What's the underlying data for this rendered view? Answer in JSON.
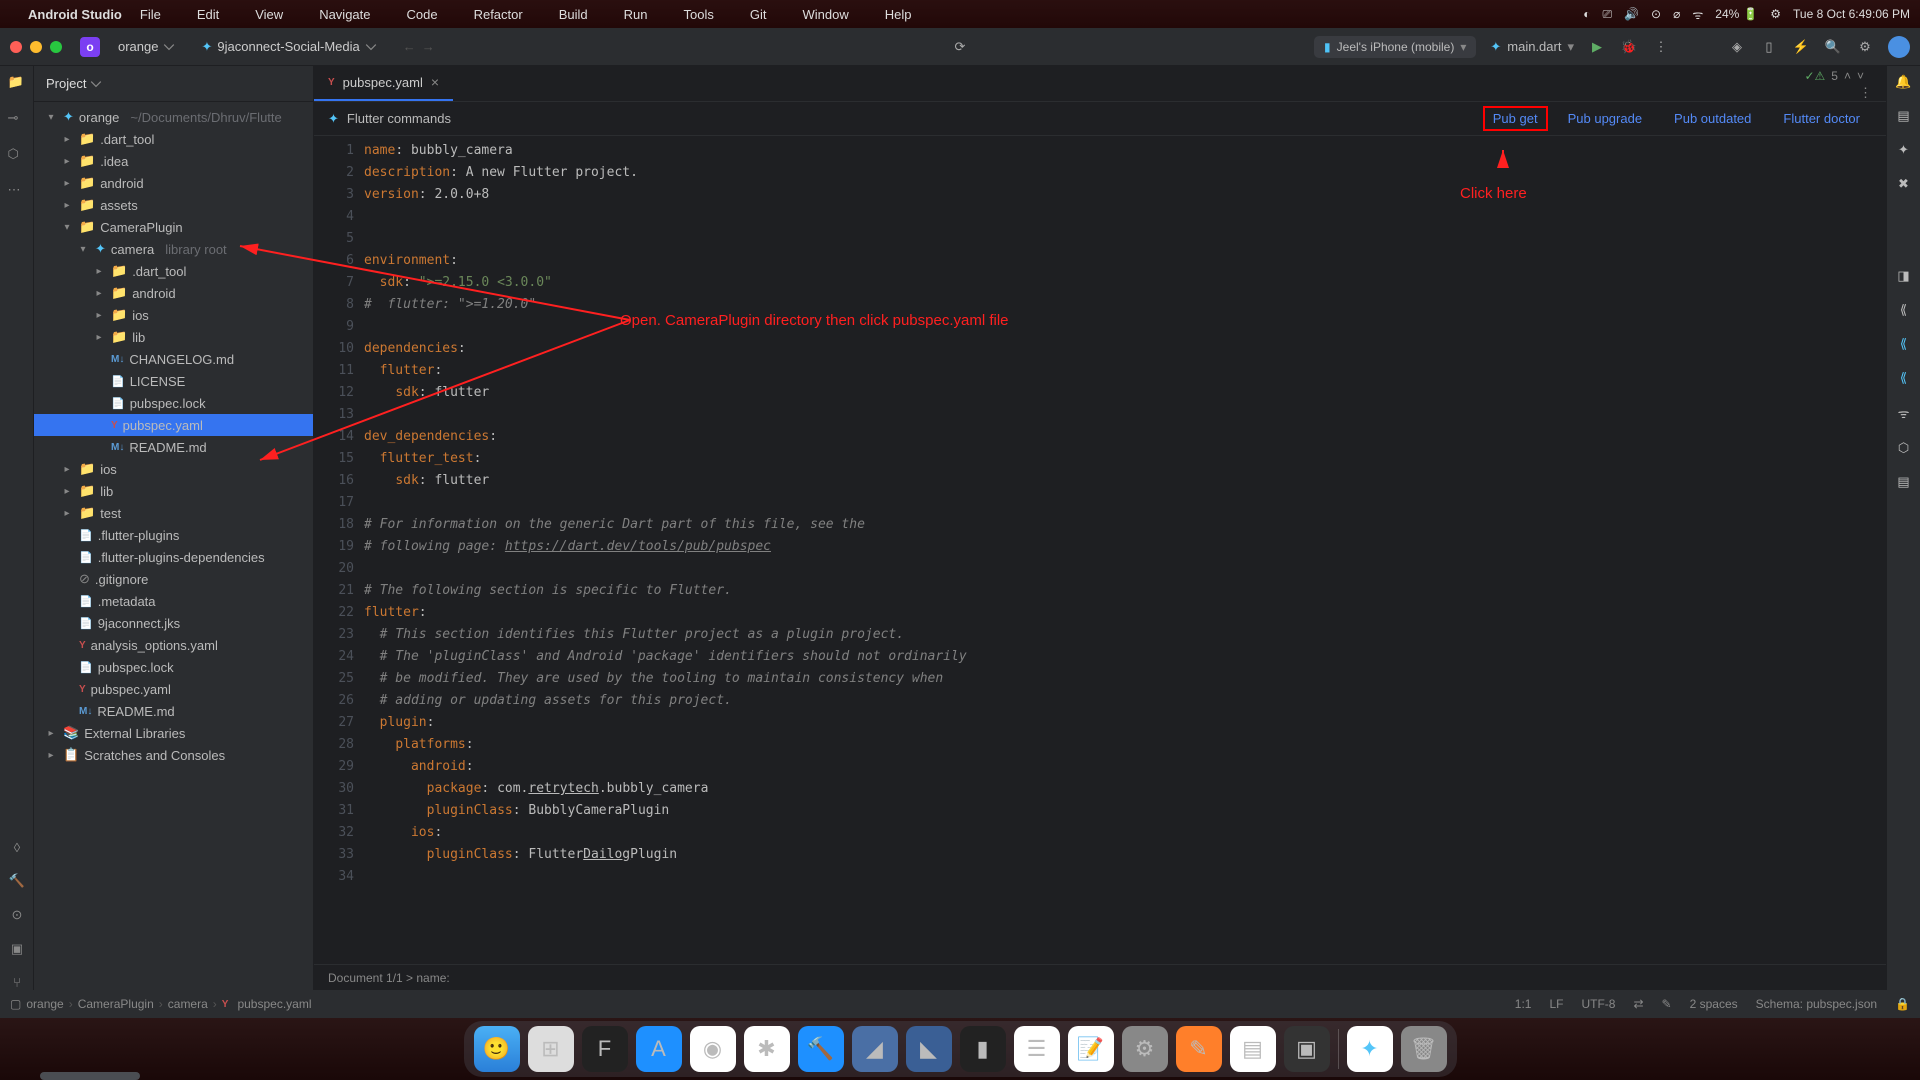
{
  "menubar": {
    "app": "Android Studio",
    "items": [
      "File",
      "Edit",
      "View",
      "Navigate",
      "Code",
      "Refactor",
      "Build",
      "Run",
      "Tools",
      "Git",
      "Window",
      "Help"
    ],
    "battery": "24%",
    "datetime": "Tue 8 Oct  6:49:06 PM"
  },
  "toolbar": {
    "project_initial": "o",
    "project_name": "orange",
    "run_config": "9jaconnect-Social-Media",
    "device": "Jeel's iPhone (mobile)",
    "main_file": "main.dart"
  },
  "project_panel": {
    "title": "Project",
    "root": "orange",
    "root_path": "~/Documents/Dhruv/Flutte",
    "items": [
      {
        "d": 1,
        "c": ">",
        "i": "folder",
        "n": ".dart_tool"
      },
      {
        "d": 1,
        "c": ">",
        "i": "folder",
        "n": ".idea"
      },
      {
        "d": 1,
        "c": ">",
        "i": "folder",
        "n": "android"
      },
      {
        "d": 1,
        "c": ">",
        "i": "folder",
        "n": "assets"
      },
      {
        "d": 1,
        "c": "v",
        "i": "folder",
        "n": "CameraPlugin"
      },
      {
        "d": 2,
        "c": "v",
        "i": "flutter",
        "n": "camera",
        "suffix": "library root"
      },
      {
        "d": 3,
        "c": ">",
        "i": "folder",
        "n": ".dart_tool"
      },
      {
        "d": 3,
        "c": ">",
        "i": "folder",
        "n": "android"
      },
      {
        "d": 3,
        "c": ">",
        "i": "folder",
        "n": "ios"
      },
      {
        "d": 3,
        "c": ">",
        "i": "folder",
        "n": "lib"
      },
      {
        "d": 3,
        "c": "",
        "i": "md",
        "n": "CHANGELOG.md"
      },
      {
        "d": 3,
        "c": "",
        "i": "file",
        "n": "LICENSE"
      },
      {
        "d": 3,
        "c": "",
        "i": "file",
        "n": "pubspec.lock"
      },
      {
        "d": 3,
        "c": "",
        "i": "yaml",
        "n": "pubspec.yaml",
        "selected": true
      },
      {
        "d": 3,
        "c": "",
        "i": "md",
        "n": "README.md"
      },
      {
        "d": 1,
        "c": ">",
        "i": "folder",
        "n": "ios"
      },
      {
        "d": 1,
        "c": ">",
        "i": "folder",
        "n": "lib"
      },
      {
        "d": 1,
        "c": ">",
        "i": "folder",
        "n": "test"
      },
      {
        "d": 1,
        "c": "",
        "i": "file",
        "n": ".flutter-plugins"
      },
      {
        "d": 1,
        "c": "",
        "i": "file",
        "n": ".flutter-plugins-dependencies"
      },
      {
        "d": 1,
        "c": "",
        "i": "gitignore",
        "n": ".gitignore"
      },
      {
        "d": 1,
        "c": "",
        "i": "file",
        "n": ".metadata"
      },
      {
        "d": 1,
        "c": "",
        "i": "file",
        "n": "9jaconnect.jks"
      },
      {
        "d": 1,
        "c": "",
        "i": "yaml",
        "n": "analysis_options.yaml"
      },
      {
        "d": 1,
        "c": "",
        "i": "file",
        "n": "pubspec.lock"
      },
      {
        "d": 1,
        "c": "",
        "i": "yaml",
        "n": "pubspec.yaml"
      },
      {
        "d": 1,
        "c": "",
        "i": "md",
        "n": "README.md"
      }
    ],
    "external": "External Libraries",
    "scratches": "Scratches and Consoles"
  },
  "tabs": {
    "active": "pubspec.yaml"
  },
  "flutter_bar": {
    "title": "Flutter commands",
    "pub_get": "Pub get",
    "pub_upgrade": "Pub upgrade",
    "pub_outdated": "Pub outdated",
    "flutter_doctor": "Flutter doctor"
  },
  "info": {
    "warnings": "5"
  },
  "code_lines": [
    {
      "n": 1,
      "h": "<span class=\"key\">name</span>: bubbly_camera"
    },
    {
      "n": 2,
      "h": "<span class=\"key\">description</span>: A new Flutter project."
    },
    {
      "n": 3,
      "h": "<span class=\"key\">version</span>: 2.0.0+8"
    },
    {
      "n": 4,
      "h": ""
    },
    {
      "n": 5,
      "h": ""
    },
    {
      "n": 6,
      "h": "<span class=\"key\">environment</span>:"
    },
    {
      "n": 7,
      "h": "  <span class=\"key\">sdk</span>: <span class=\"str\">\">=2.15.0 &lt;3.0.0\"</span>"
    },
    {
      "n": 8,
      "h": "<span class=\"cmt\">#  flutter: \">=1.20.0\"</span>"
    },
    {
      "n": 9,
      "h": ""
    },
    {
      "n": 10,
      "h": "<span class=\"key\">dependencies</span>:"
    },
    {
      "n": 11,
      "h": "  <span class=\"key\">flutter</span>:"
    },
    {
      "n": 12,
      "h": "    <span class=\"key\">sdk</span>: flutter"
    },
    {
      "n": 13,
      "h": ""
    },
    {
      "n": 14,
      "h": "<span class=\"key\">dev_dependencies</span>:"
    },
    {
      "n": 15,
      "h": "  <span class=\"key\">flutter_test</span>:"
    },
    {
      "n": 16,
      "h": "    <span class=\"key\">sdk</span>: flutter"
    },
    {
      "n": 17,
      "h": ""
    },
    {
      "n": 18,
      "h": "<span class=\"cmt\"># For information on the generic Dart part of this file, see the</span>"
    },
    {
      "n": 19,
      "h": "<span class=\"cmt\"># following page: <span class=\"link\">https://dart.dev/tools/pub/pubspec</span></span>"
    },
    {
      "n": 20,
      "h": ""
    },
    {
      "n": 21,
      "h": "<span class=\"cmt\"># The following section is specific to Flutter.</span>"
    },
    {
      "n": 22,
      "h": "<span class=\"key\">flutter</span>:"
    },
    {
      "n": 23,
      "h": "  <span class=\"cmt\"># This section identifies this Flutter project as a plugin project.</span>"
    },
    {
      "n": 24,
      "h": "  <span class=\"cmt\"># The 'pluginClass' and Android 'package' identifiers should not ordinarily</span>"
    },
    {
      "n": 25,
      "h": "  <span class=\"cmt\"># be modified. They are used by the tooling to maintain consistency when</span>"
    },
    {
      "n": 26,
      "h": "  <span class=\"cmt\"># adding or updating assets for this project.</span>"
    },
    {
      "n": 27,
      "h": "  <span class=\"key\">plugin</span>:"
    },
    {
      "n": 28,
      "h": "    <span class=\"key\">platforms</span>:"
    },
    {
      "n": 29,
      "h": "      <span class=\"key\">android</span>:"
    },
    {
      "n": 30,
      "h": "        <span class=\"key\">package</span>: com.<u>retrytech</u>.bubbly_camera"
    },
    {
      "n": 31,
      "h": "        <span class=\"key\">pluginClass</span>: BubblyCameraPlugin"
    },
    {
      "n": 32,
      "h": "      <span class=\"key\">ios</span>:"
    },
    {
      "n": 33,
      "h": "        <span class=\"key\">pluginClass</span>: Flutter<u>Dailog</u>Plugin"
    },
    {
      "n": 34,
      "h": ""
    }
  ],
  "editor_footer": "Document 1/1  >  name:",
  "breadcrumb": [
    "orange",
    "CameraPlugin",
    "camera",
    "pubspec.yaml"
  ],
  "status": {
    "pos": "1:1",
    "lf": "LF",
    "enc": "UTF-8",
    "spaces": "2 spaces",
    "schema": "Schema: pubspec.json"
  },
  "annotations": {
    "click_here": "Click here",
    "open_dir": "Open. CameraPlugin directory then click pubspec.yaml file"
  }
}
